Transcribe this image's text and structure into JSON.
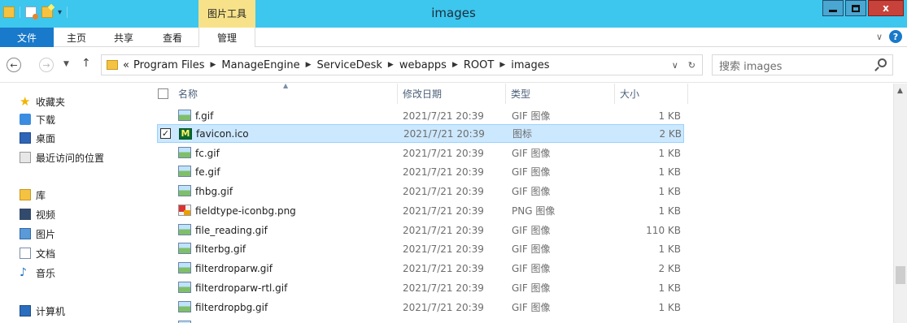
{
  "titlebar": {
    "title": "images",
    "contextual_tab": "图片工具"
  },
  "ribbon": {
    "tabs": [
      "文件",
      "主页",
      "共享",
      "查看",
      "管理"
    ]
  },
  "address": {
    "crumbs": [
      "Program Files",
      "ManageEngine",
      "ServiceDesk",
      "webapps",
      "ROOT",
      "images"
    ],
    "overflow": "«"
  },
  "search": {
    "placeholder": "搜索 images"
  },
  "navpane": {
    "favorites": "收藏夹",
    "downloads": "下载",
    "desktop": "桌面",
    "recent": "最近访问的位置",
    "library": "库",
    "videos": "视频",
    "pictures": "图片",
    "documents": "文档",
    "music": "音乐",
    "computer": "计算机"
  },
  "columns": {
    "name": "名称",
    "date": "修改日期",
    "type": "类型",
    "size": "大小"
  },
  "files": [
    {
      "name": "f.gif",
      "date": "2021/7/21 20:39",
      "type": "GIF 图像",
      "size": "1 KB",
      "icon": "gif"
    },
    {
      "name": "favicon.ico",
      "date": "2021/7/21 20:39",
      "type": "图标",
      "size": "2 KB",
      "icon": "ico",
      "selected": true
    },
    {
      "name": "fc.gif",
      "date": "2021/7/21 20:39",
      "type": "GIF 图像",
      "size": "1 KB",
      "icon": "gif"
    },
    {
      "name": "fe.gif",
      "date": "2021/7/21 20:39",
      "type": "GIF 图像",
      "size": "1 KB",
      "icon": "gif"
    },
    {
      "name": "fhbg.gif",
      "date": "2021/7/21 20:39",
      "type": "GIF 图像",
      "size": "1 KB",
      "icon": "gif"
    },
    {
      "name": "fieldtype-iconbg.png",
      "date": "2021/7/21 20:39",
      "type": "PNG 图像",
      "size": "1 KB",
      "icon": "png"
    },
    {
      "name": "file_reading.gif",
      "date": "2021/7/21 20:39",
      "type": "GIF 图像",
      "size": "110 KB",
      "icon": "gif"
    },
    {
      "name": "filterbg.gif",
      "date": "2021/7/21 20:39",
      "type": "GIF 图像",
      "size": "1 KB",
      "icon": "gif"
    },
    {
      "name": "filterdroparw.gif",
      "date": "2021/7/21 20:39",
      "type": "GIF 图像",
      "size": "2 KB",
      "icon": "gif"
    },
    {
      "name": "filterdroparw-rtl.gif",
      "date": "2021/7/21 20:39",
      "type": "GIF 图像",
      "size": "1 KB",
      "icon": "gif"
    },
    {
      "name": "filterdropbg.gif",
      "date": "2021/7/21 20:39",
      "type": "GIF 图像",
      "size": "1 KB",
      "icon": "gif"
    }
  ]
}
